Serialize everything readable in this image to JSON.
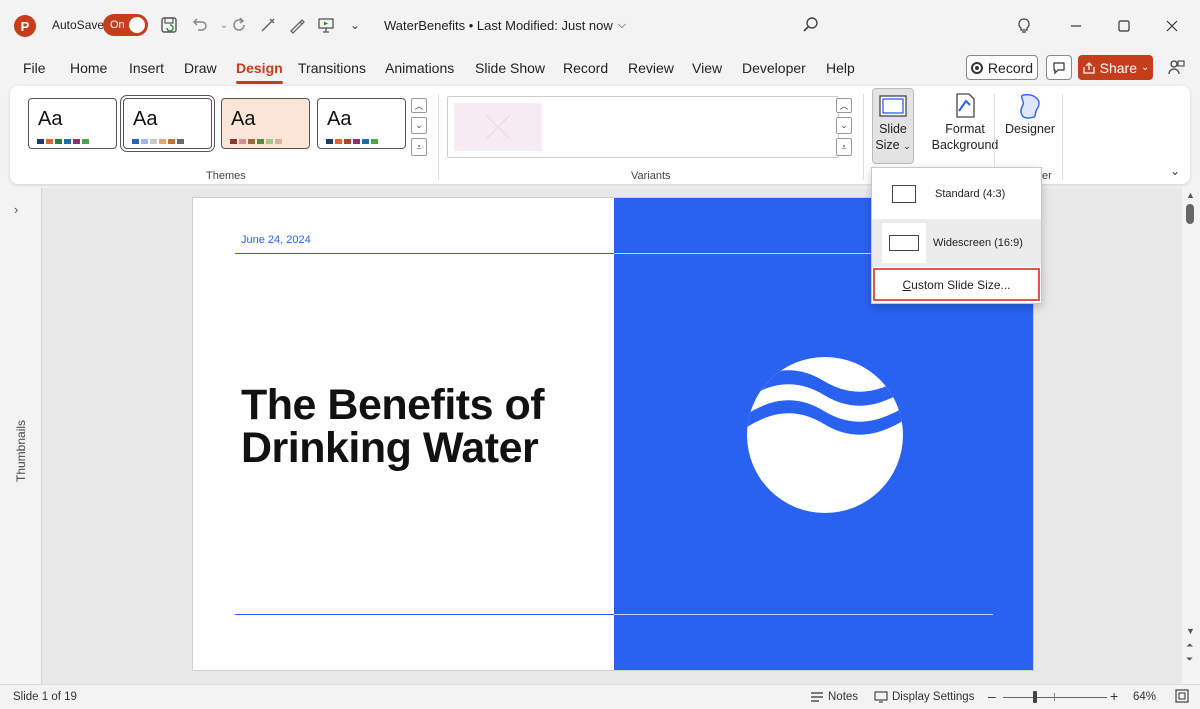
{
  "window": {
    "app_logo_letter": "P",
    "autosave_label": "AutoSave",
    "autosave_state": "On",
    "doc_title": "WaterBenefits • Last Modified: Just now",
    "icons": [
      "save-sync-icon",
      "undo-icon",
      "redo-icon",
      "touch-draw-icon",
      "pen-icon",
      "present-icon",
      "customize-qat-icon"
    ]
  },
  "menu": {
    "tabs": [
      "File",
      "Home",
      "Insert",
      "Draw",
      "Design",
      "Transitions",
      "Animations",
      "Slide Show",
      "Record",
      "Review",
      "View",
      "Developer",
      "Help"
    ],
    "active_tab": "Design",
    "record_label": "Record",
    "share_label": "Share"
  },
  "ribbon": {
    "themes_label": "Themes",
    "variants_label": "Variants",
    "theme_aa": "Aa",
    "slide_size_label_1": "Slide",
    "slide_size_label_2": "Size",
    "format_bg_label_1": "Format",
    "format_bg_label_2": "Background",
    "designer_label": "Designer",
    "designer_group_fragment": "er",
    "themes": [
      {
        "bg": "#ffffff",
        "colors": [
          "#1f3b6e",
          "#e0662b",
          "#2f7a3b",
          "#1c6fb6",
          "#8a2f7a",
          "#4aa84a"
        ]
      },
      {
        "bg": "#ffffff",
        "colors": [
          "#2a5fc4",
          "#9fb6e6",
          "#c9c9c9",
          "#e0a66d",
          "#e0662b",
          "#6a6a6a"
        ]
      },
      {
        "bg": "#fbe5d6",
        "colors": [
          "#8a3b2a",
          "#d98b9a",
          "#9a6a3a",
          "#5a8a3a",
          "#a8c48a",
          "#d8b0a0"
        ]
      },
      {
        "bg": "#ffffff",
        "colors": [
          "#1f3b6e",
          "#e0662b",
          "#c0392b",
          "#8a2f7a",
          "#1c6fb6",
          "#4aa84a"
        ]
      }
    ]
  },
  "sidebar": {
    "label": "Thumbnails"
  },
  "slide": {
    "date": "June 24, 2024",
    "title": "The Benefits of Drinking Water",
    "accent": "#2962f0"
  },
  "dropdown": {
    "items": [
      {
        "label": "Standard (4:3)"
      },
      {
        "label": "Widescreen (16:9)"
      }
    ],
    "custom_label_underlined": "C",
    "custom_label_rest": "ustom Slide Size..."
  },
  "status": {
    "slide_count": "Slide 1 of 19",
    "notes_label": "Notes",
    "display_settings_label": "Display Settings",
    "zoom_level": "64%",
    "zoom_out": "–",
    "zoom_in": "+"
  }
}
